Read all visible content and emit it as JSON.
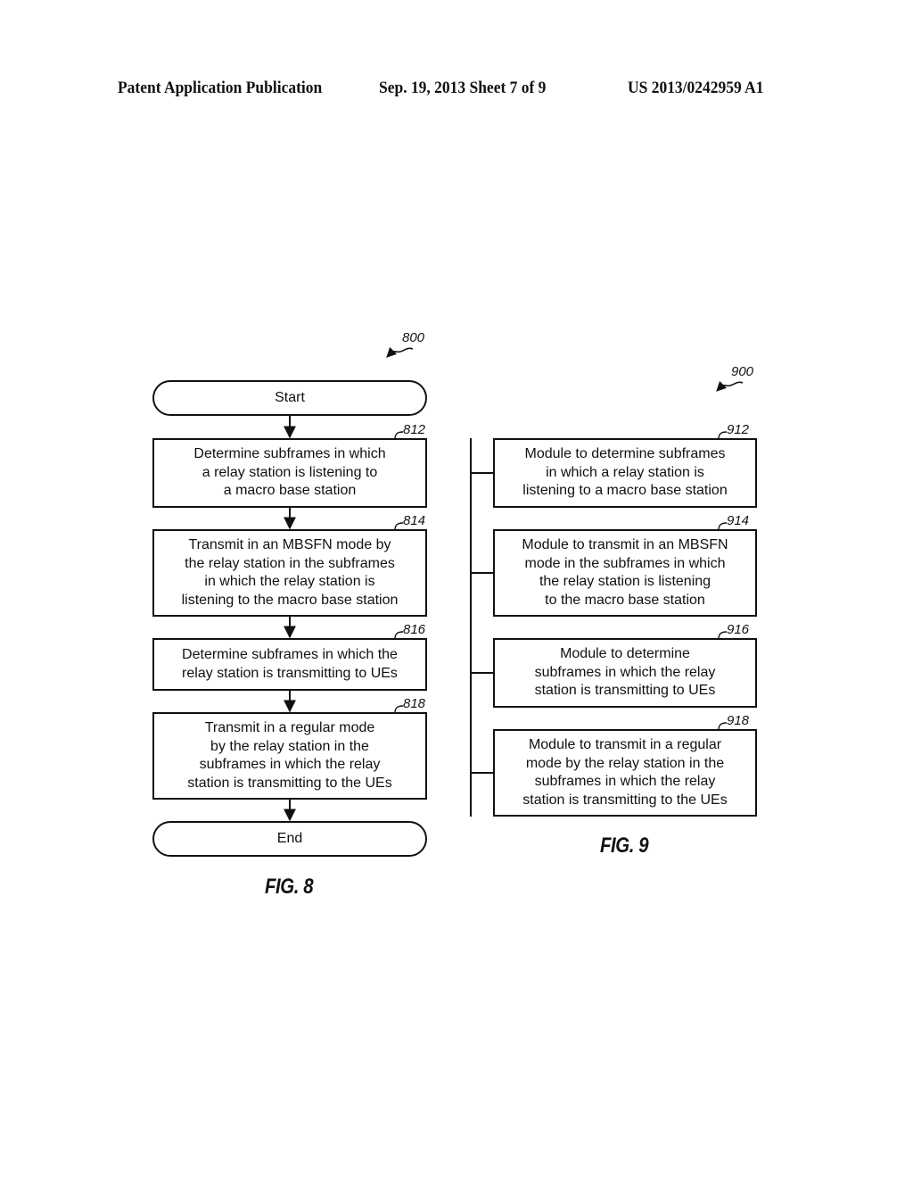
{
  "header": {
    "left": "Patent Application Publication",
    "middle": "Sep. 19, 2013   Sheet 7 of 9",
    "right": "US 2013/0242959 A1"
  },
  "fig8": {
    "ref": "800",
    "label": "FIG. 8",
    "start": "Start",
    "end": "End",
    "steps": [
      {
        "ref": "812",
        "text": "Determine subframes in which\na relay station is listening to\na macro base station"
      },
      {
        "ref": "814",
        "text": "Transmit in an MBSFN mode by\nthe relay station in the subframes\nin which the relay station is\nlistening to the macro base station"
      },
      {
        "ref": "816",
        "text": "Determine subframes in which the\nrelay station is transmitting to UEs"
      },
      {
        "ref": "818",
        "text": "Transmit in a regular mode\nby the relay station in the\nsubframes in which the relay\nstation is transmitting to the UEs"
      }
    ]
  },
  "fig9": {
    "ref": "900",
    "label": "FIG. 9",
    "modules": [
      {
        "ref": "912",
        "text": "Module to determine subframes\nin which a relay station is\nlistening to a macro base station"
      },
      {
        "ref": "914",
        "text": "Module to transmit in an MBSFN\nmode in the subframes in which\nthe relay station is listening\nto the macro base station"
      },
      {
        "ref": "916",
        "text": "Module to determine\nsubframes in which the relay\nstation is transmitting to UEs"
      },
      {
        "ref": "918",
        "text": "Module to transmit in a regular\nmode by the relay station in the\nsubframes in which the relay\nstation is transmitting to the UEs"
      }
    ]
  }
}
